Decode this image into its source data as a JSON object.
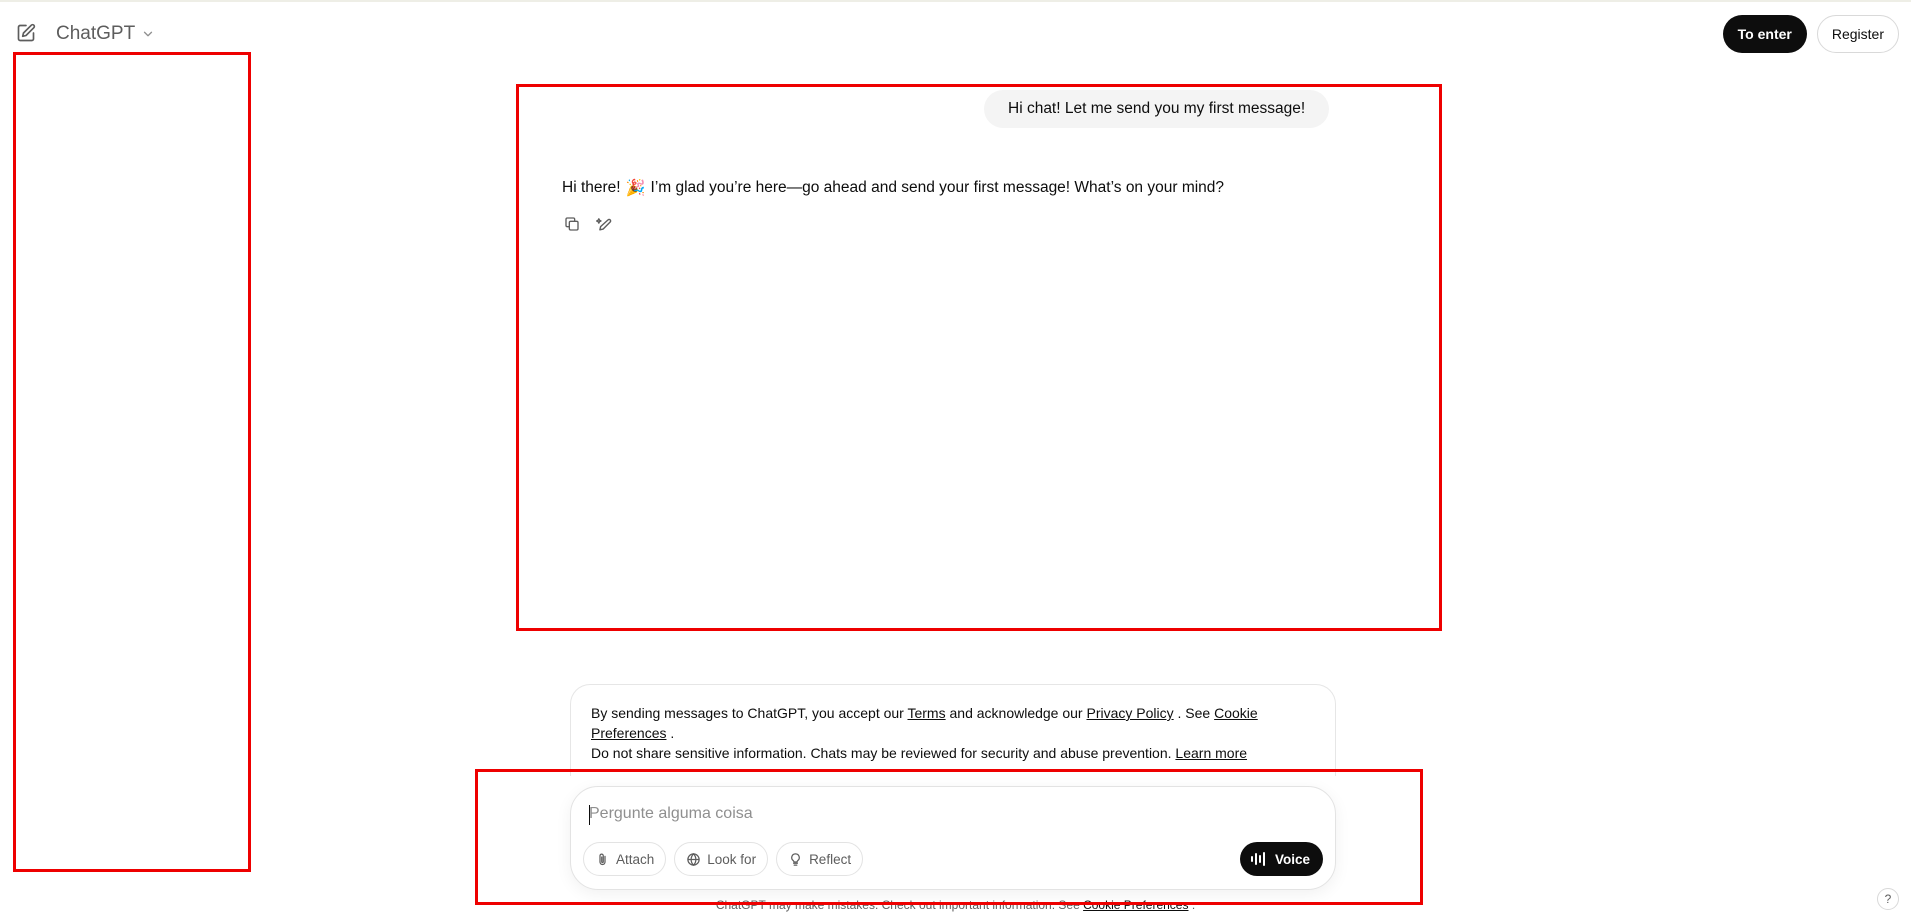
{
  "header": {
    "model_name": "ChatGPT",
    "login_label": "To enter",
    "register_label": "Register"
  },
  "conversation": {
    "user_message": "Hi chat! Let me send you my first message!",
    "assistant_message_before": "Hi there!",
    "assistant_emoji": "🎉",
    "assistant_message_after": "I’m glad you’re here—go ahead and send your first message! What’s on your mind?"
  },
  "terms": {
    "t1": "By sending messages to ChatGPT, you accept our",
    "terms_link": "Terms",
    "t2": "and acknowledge our",
    "privacy_link": "Privacy Policy",
    "t3": ". See",
    "cookie_link": "Cookie Preferences",
    "t4": ".",
    "line2": "Do not share sensitive information. Chats may be reviewed for security and abuse prevention.",
    "learn_more": "Learn more"
  },
  "composer": {
    "placeholder": "Pergunte alguma coisa",
    "attach_label": "Attach",
    "search_label": "Look for",
    "reflect_label": "Reflect",
    "voice_label": "Voice"
  },
  "footer": {
    "note": "ChatGPT may make mistakes. Check out important information. See",
    "cookie_link": "Cookie Preferences",
    "end": ".",
    "help": "?"
  },
  "colors": {
    "annotation": "#ee0000",
    "primary": "#0d0d0d",
    "bubble": "#f4f4f4"
  }
}
